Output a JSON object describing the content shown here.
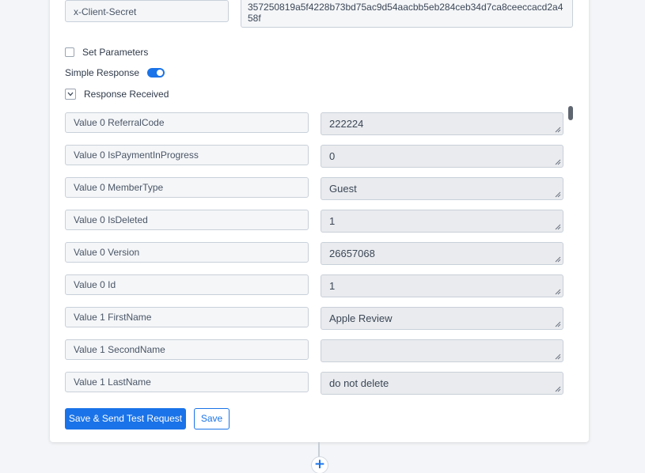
{
  "header_field": {
    "key": "x-Client-Secret",
    "value": "357250819a5f4228b73bd75ac9d54aacbb5eb284ceb34d7ca8ceeccacd2a458f"
  },
  "options": {
    "set_parameters_label": "Set Parameters",
    "simple_response_label": "Simple Response",
    "simple_response_enabled": true,
    "response_received_label": "Response Received"
  },
  "response_rows": [
    {
      "key": "Value 0 ReferralCode",
      "value": "222224"
    },
    {
      "key": "Value 0 IsPaymentInProgress",
      "value": "0"
    },
    {
      "key": "Value 0 MemberType",
      "value": "Guest"
    },
    {
      "key": "Value 0 IsDeleted",
      "value": "1"
    },
    {
      "key": "Value 0 Version",
      "value": "26657068"
    },
    {
      "key": "Value 0 Id",
      "value": "1"
    },
    {
      "key": "Value 1 FirstName",
      "value": "Apple Review"
    },
    {
      "key": "Value 1 SecondName",
      "value": ""
    },
    {
      "key": "Value 1 LastName",
      "value": "do not delete"
    }
  ],
  "actions": {
    "save_send_label": "Save & Send Test Request",
    "save_label": "Save",
    "add_step_symbol": "+"
  },
  "colors": {
    "accent": "#1a73e8",
    "background": "#f3f5f8"
  }
}
